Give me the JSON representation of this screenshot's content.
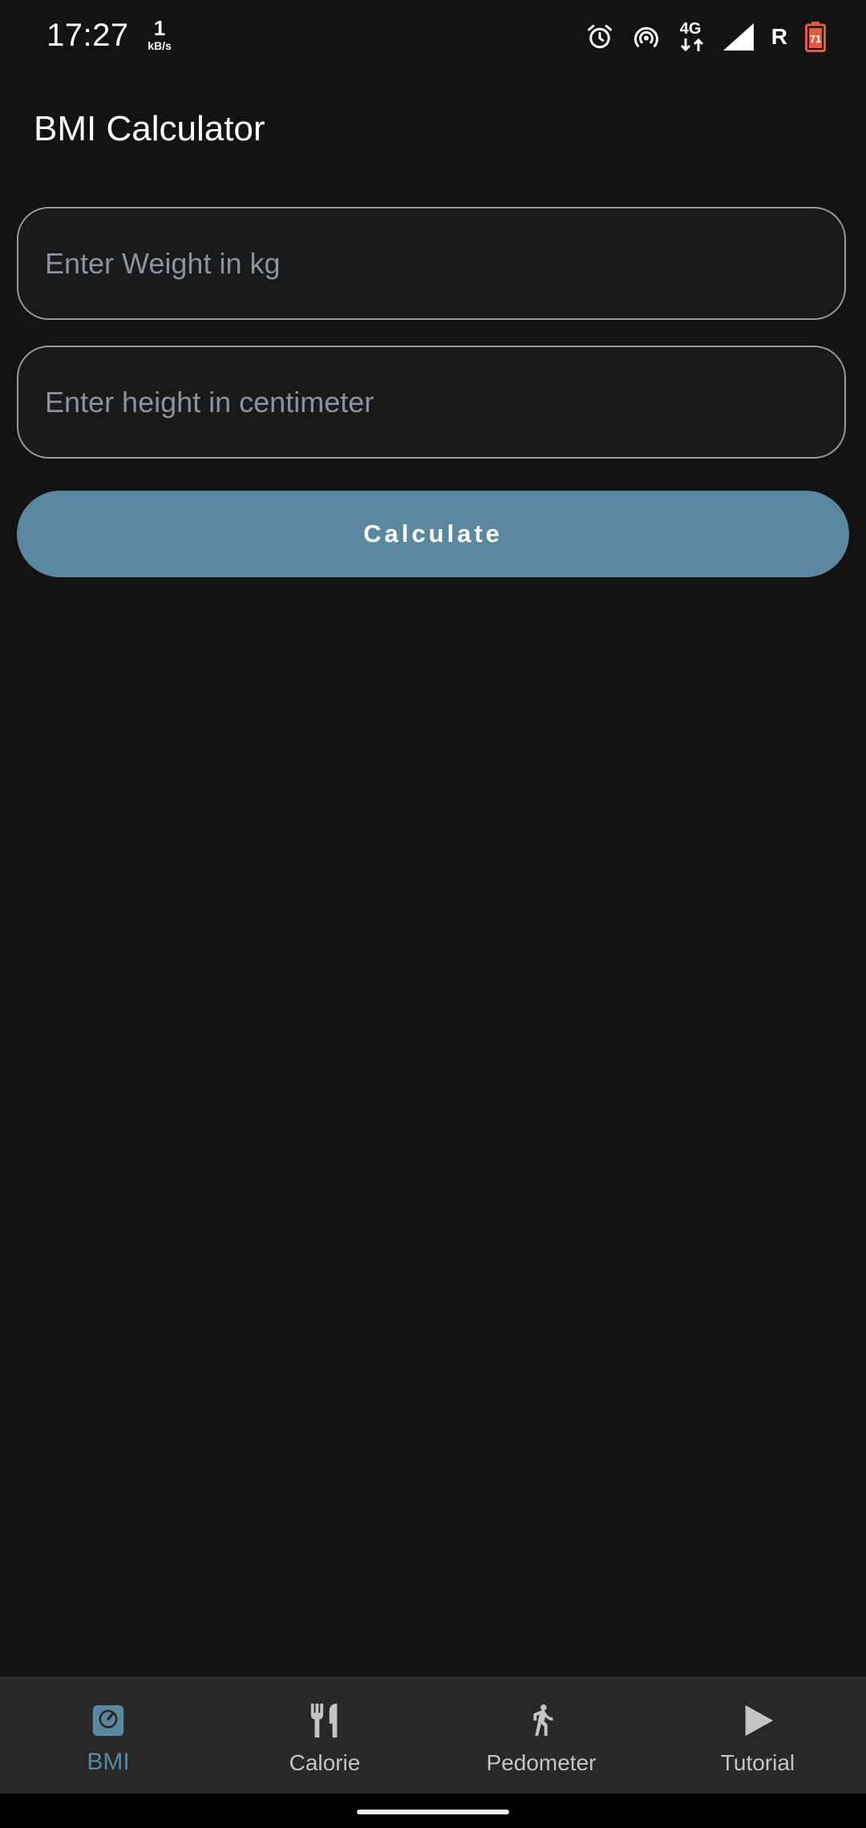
{
  "status_bar": {
    "time": "17:27",
    "net_speed_value": "1",
    "net_speed_unit": "kB/s",
    "network_type": "4G",
    "roaming": "R",
    "battery_level": "71"
  },
  "app_bar": {
    "title": "BMI Calculator"
  },
  "form": {
    "weight_placeholder": "Enter Weight in kg",
    "height_placeholder": "Enter height in centimeter",
    "weight_value": "",
    "height_value": "",
    "calculate_label": "Calculate"
  },
  "bottom_nav": {
    "items": [
      {
        "label": "BMI",
        "icon": "scale-icon",
        "active": true
      },
      {
        "label": "Calorie",
        "icon": "restaurant-icon",
        "active": false
      },
      {
        "label": "Pedometer",
        "icon": "walk-icon",
        "active": false
      },
      {
        "label": "Tutorial",
        "icon": "play-icon",
        "active": false
      }
    ]
  },
  "colors": {
    "accent": "#5a889f",
    "background": "#131313",
    "nav_background": "#282828",
    "battery_low": "#e45b3c"
  }
}
